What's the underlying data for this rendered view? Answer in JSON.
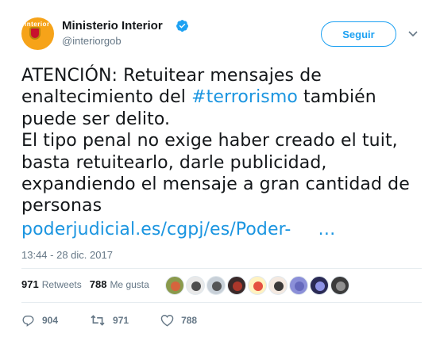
{
  "author": {
    "name": "Ministerio Interior",
    "handle": "@interiorgob",
    "avatar_logo_text": "interior",
    "verified": true
  },
  "follow_button": {
    "label": "Seguir"
  },
  "tweet": {
    "lines": [
      "ATENCIÓN: Retuitear mensajes de",
      "enaltecimiento del ",
      "#terrorismo",
      " también",
      "puede ser delito.",
      "El tipo penal no exige haber creado el tuit,",
      "basta retuitearlo, darle publicidad,",
      "expandiendo el mensaje a gran cantidad de",
      "personas"
    ],
    "link": "poderjudicial.es/cgpj/es/Poder-",
    "link_ellipsis": "…"
  },
  "timestamp": "13:44 - 28 dic. 2017",
  "stats": {
    "retweets_count": "971",
    "retweets_label": "Retweets",
    "likes_count": "788",
    "likes_label": "Me gusta"
  },
  "likers": [
    {
      "color": "#8a9a4c",
      "accent": "#e35a3b"
    },
    {
      "color": "#e9e9e9",
      "accent": "#333333"
    },
    {
      "color": "#c8d0d8",
      "accent": "#404040"
    },
    {
      "color": "#3a2a2a",
      "accent": "#c0392b"
    },
    {
      "color": "#fff2c0",
      "accent": "#e0342a"
    },
    {
      "color": "#f4e9e0",
      "accent": "#1a1a1a"
    },
    {
      "color": "#8b8fd8",
      "accent": "#5f63b8"
    },
    {
      "color": "#2a2a55",
      "accent": "#9fa4ff"
    },
    {
      "color": "#3b3b3b",
      "accent": "#a0a0a0"
    }
  ],
  "actions": {
    "replies": "904",
    "retweets": "971",
    "likes": "788"
  },
  "colors": {
    "accent": "#1da1f2",
    "link": "#1b95e0",
    "muted": "#657786",
    "avatar_bg": "#f6a319"
  }
}
